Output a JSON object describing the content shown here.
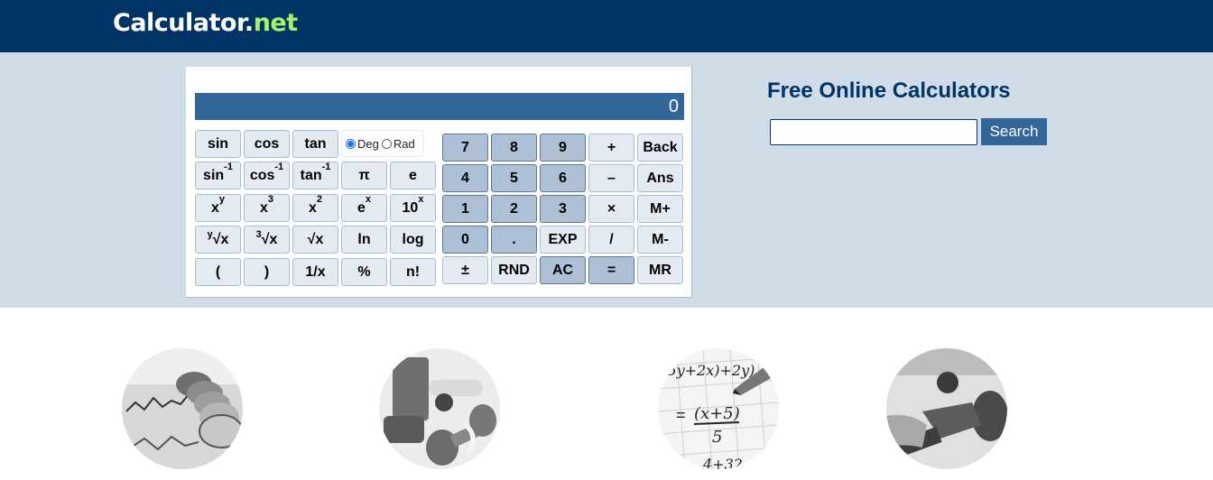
{
  "header": {
    "logo_main": "Calculator",
    "logo_dot": ".",
    "logo_tld": "net",
    "colors": {
      "bar": "#003366",
      "tld": "#a9f06a"
    }
  },
  "calculator": {
    "display_value": "0",
    "angle_mode": {
      "options": [
        "Deg",
        "Rad"
      ],
      "selected": "Deg"
    },
    "scientific_keys": {
      "row1": [
        "sin",
        "cos",
        "tan"
      ],
      "row2": [
        {
          "base": "sin",
          "sup": "-1"
        },
        {
          "base": "cos",
          "sup": "-1"
        },
        {
          "base": "tan",
          "sup": "-1"
        },
        {
          "base": "π",
          "sup": ""
        },
        {
          "base": "e",
          "sup": ""
        }
      ],
      "row3": [
        {
          "base": "x",
          "sup": "y"
        },
        {
          "base": "x",
          "sup": "3"
        },
        {
          "base": "x",
          "sup": "2"
        },
        {
          "base": "e",
          "sup": "x"
        },
        {
          "base": "10",
          "sup": "x"
        }
      ],
      "row4": [
        {
          "pre": "y",
          "base": "√x"
        },
        {
          "pre": "3",
          "base": "√x"
        },
        {
          "pre": "",
          "base": "√x"
        },
        {
          "pre": "",
          "base": "ln"
        },
        {
          "pre": "",
          "base": "log"
        }
      ],
      "row5": [
        "(",
        ")",
        "1/x",
        "%",
        "n!"
      ]
    },
    "numeric_keys": {
      "row1": [
        "7",
        "8",
        "9",
        "+",
        "Back"
      ],
      "row2": [
        "4",
        "5",
        "6",
        "–",
        "Ans"
      ],
      "row3": [
        "1",
        "2",
        "3",
        "×",
        "M+"
      ],
      "row4": [
        "0",
        ".",
        "EXP",
        "/",
        "M-"
      ],
      "row5": [
        "±",
        "RND",
        "AC",
        "=",
        "MR"
      ]
    },
    "colors": {
      "display_bg": "#336699",
      "key_light": "#e3eaf2",
      "key_dark": "#adc0d5"
    }
  },
  "sidebar": {
    "title": "Free Online Calculators",
    "search": {
      "value": "",
      "placeholder": "",
      "button_label": "Search"
    }
  },
  "categories": [
    {
      "image": "financial-image",
      "description": "coins on financial chart"
    },
    {
      "image": "fitness-health-image",
      "description": "dumbbells, juice and measuring tape"
    },
    {
      "image": "math-image",
      "description": "handwritten equation with pencil"
    },
    {
      "image": "other-image",
      "description": "fuel nozzle refilling a car"
    }
  ]
}
